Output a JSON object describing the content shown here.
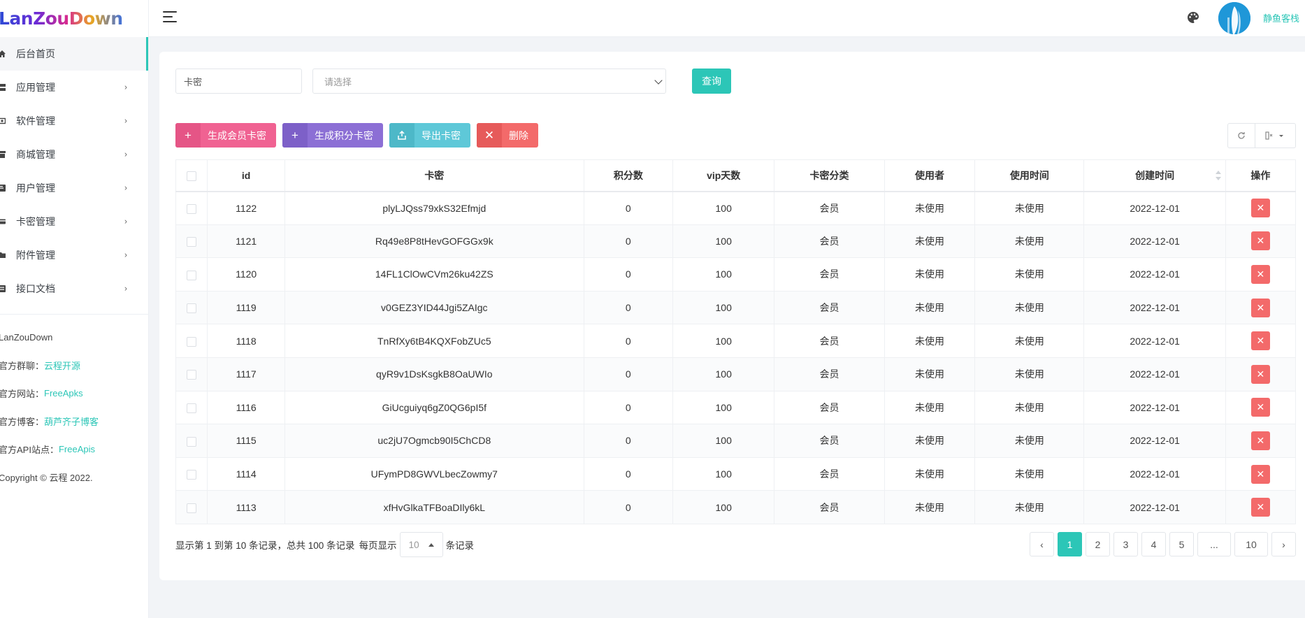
{
  "app": {
    "logo": "LanZouDown"
  },
  "sidebar": {
    "items": [
      {
        "label": "后台首页",
        "icon": "home-icon",
        "active": true,
        "has_children": false
      },
      {
        "label": "应用管理",
        "icon": "app-icon",
        "active": false,
        "has_children": true
      },
      {
        "label": "软件管理",
        "icon": "software-icon",
        "active": false,
        "has_children": true
      },
      {
        "label": "商城管理",
        "icon": "shop-icon",
        "active": false,
        "has_children": true
      },
      {
        "label": "用户管理",
        "icon": "user-icon",
        "active": false,
        "has_children": true
      },
      {
        "label": "卡密管理",
        "icon": "card-icon",
        "active": false,
        "has_children": true
      },
      {
        "label": "附件管理",
        "icon": "folder-icon",
        "active": false,
        "has_children": true
      },
      {
        "label": "接口文档",
        "icon": "doc-icon",
        "active": false,
        "has_children": true
      }
    ],
    "info": {
      "name": "LanZouDown",
      "group_label": "官方群聊：",
      "group_link": "云程开源",
      "site_label": "官方网站：",
      "site_link": "FreeApks",
      "blog_label": "官方博客：",
      "blog_link": "葫芦齐子博客",
      "api_label": "官方API站点：",
      "api_link": "FreeApis",
      "copyright": "Copyright © 云程 2022."
    }
  },
  "header": {
    "username": "静鱼客栈"
  },
  "search": {
    "input_value": "卡密",
    "select_placeholder": "请选择",
    "query_label": "查询"
  },
  "toolbar": {
    "gen_member": "生成会员卡密",
    "gen_points": "生成积分卡密",
    "export": "导出卡密",
    "delete": "删除"
  },
  "table": {
    "columns": [
      "id",
      "卡密",
      "积分数",
      "vip天数",
      "卡密分类",
      "使用者",
      "使用时间",
      "创建时间",
      "操作"
    ],
    "rows": [
      {
        "id": "1122",
        "code": "plyLJQss79xkS32Efmjd",
        "points": "0",
        "vip": "100",
        "type": "会员",
        "user": "未使用",
        "used": "未使用",
        "created": "2022-12-01"
      },
      {
        "id": "1121",
        "code": "Rq49e8P8tHevGOFGGx9k",
        "points": "0",
        "vip": "100",
        "type": "会员",
        "user": "未使用",
        "used": "未使用",
        "created": "2022-12-01"
      },
      {
        "id": "1120",
        "code": "14FL1ClOwCVm26ku42ZS",
        "points": "0",
        "vip": "100",
        "type": "会员",
        "user": "未使用",
        "used": "未使用",
        "created": "2022-12-01"
      },
      {
        "id": "1119",
        "code": "v0GEZ3YID44Jgi5ZAIgc",
        "points": "0",
        "vip": "100",
        "type": "会员",
        "user": "未使用",
        "used": "未使用",
        "created": "2022-12-01"
      },
      {
        "id": "1118",
        "code": "TnRfXy6tB4KQXFobZUc5",
        "points": "0",
        "vip": "100",
        "type": "会员",
        "user": "未使用",
        "used": "未使用",
        "created": "2022-12-01"
      },
      {
        "id": "1117",
        "code": "qyR9v1DsKsgkB8OaUWIo",
        "points": "0",
        "vip": "100",
        "type": "会员",
        "user": "未使用",
        "used": "未使用",
        "created": "2022-12-01"
      },
      {
        "id": "1116",
        "code": "GiUcguiyq6gZ0QG6pI5f",
        "points": "0",
        "vip": "100",
        "type": "会员",
        "user": "未使用",
        "used": "未使用",
        "created": "2022-12-01"
      },
      {
        "id": "1115",
        "code": "uc2jU7Ogmcb90I5ChCD8",
        "points": "0",
        "vip": "100",
        "type": "会员",
        "user": "未使用",
        "used": "未使用",
        "created": "2022-12-01"
      },
      {
        "id": "1114",
        "code": "UFymPD8GWVLbecZowmy7",
        "points": "0",
        "vip": "100",
        "type": "会员",
        "user": "未使用",
        "used": "未使用",
        "created": "2022-12-01"
      },
      {
        "id": "1113",
        "code": "xfHvGlkaTFBoaDIly6kL",
        "points": "0",
        "vip": "100",
        "type": "会员",
        "user": "未使用",
        "used": "未使用",
        "created": "2022-12-01"
      }
    ]
  },
  "pagination": {
    "summary": "显示第 1 到第 10 条记录，总共 100 条记录",
    "per_page_label": "每页显示",
    "per_page_value": "10",
    "per_page_suffix": "条记录",
    "prev": "‹",
    "next": "›",
    "pages": [
      "1",
      "2",
      "3",
      "4",
      "5",
      "...",
      "10"
    ],
    "current": "1"
  },
  "colors": {
    "accent": "#2cc6b7",
    "pink": "#f06292",
    "purple": "#8c6fd5",
    "cyan": "#5ec8d8",
    "red": "#f36a6a"
  }
}
